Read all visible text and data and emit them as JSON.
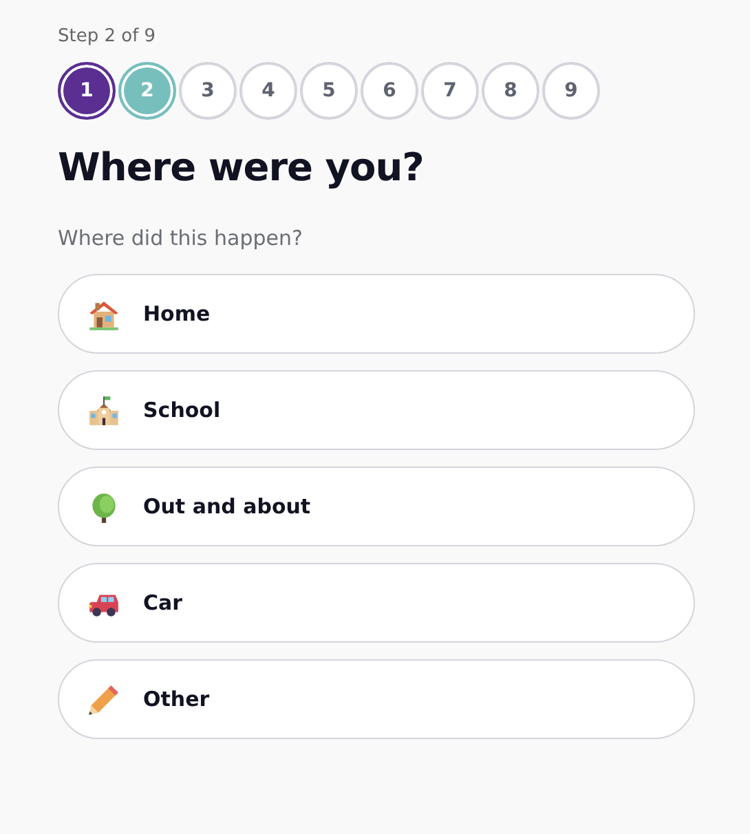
{
  "step_label": "Step 2 of 9",
  "steps": [
    {
      "label": "1",
      "completed": true,
      "selected": false
    },
    {
      "label": "2",
      "completed": false,
      "selected": true
    },
    {
      "label": "3",
      "completed": false,
      "selected": false
    },
    {
      "label": "4",
      "completed": false,
      "selected": false
    },
    {
      "label": "5",
      "completed": false,
      "selected": false
    },
    {
      "label": "6",
      "completed": false,
      "selected": false
    },
    {
      "label": "7",
      "completed": false,
      "selected": false
    },
    {
      "label": "8",
      "completed": false,
      "selected": false
    },
    {
      "label": "9",
      "completed": false,
      "selected": false
    }
  ],
  "title": "Where were you?",
  "prompt": "Where did this happen?",
  "options": [
    {
      "kind": "house",
      "label": "Home",
      "selected": false
    },
    {
      "kind": "school",
      "label": "School",
      "selected": false
    },
    {
      "kind": "tree",
      "label": "Out and about",
      "selected": false
    },
    {
      "kind": "car",
      "label": "Car",
      "selected": false
    },
    {
      "kind": "pencil",
      "label": "Other",
      "selected": false
    }
  ]
}
